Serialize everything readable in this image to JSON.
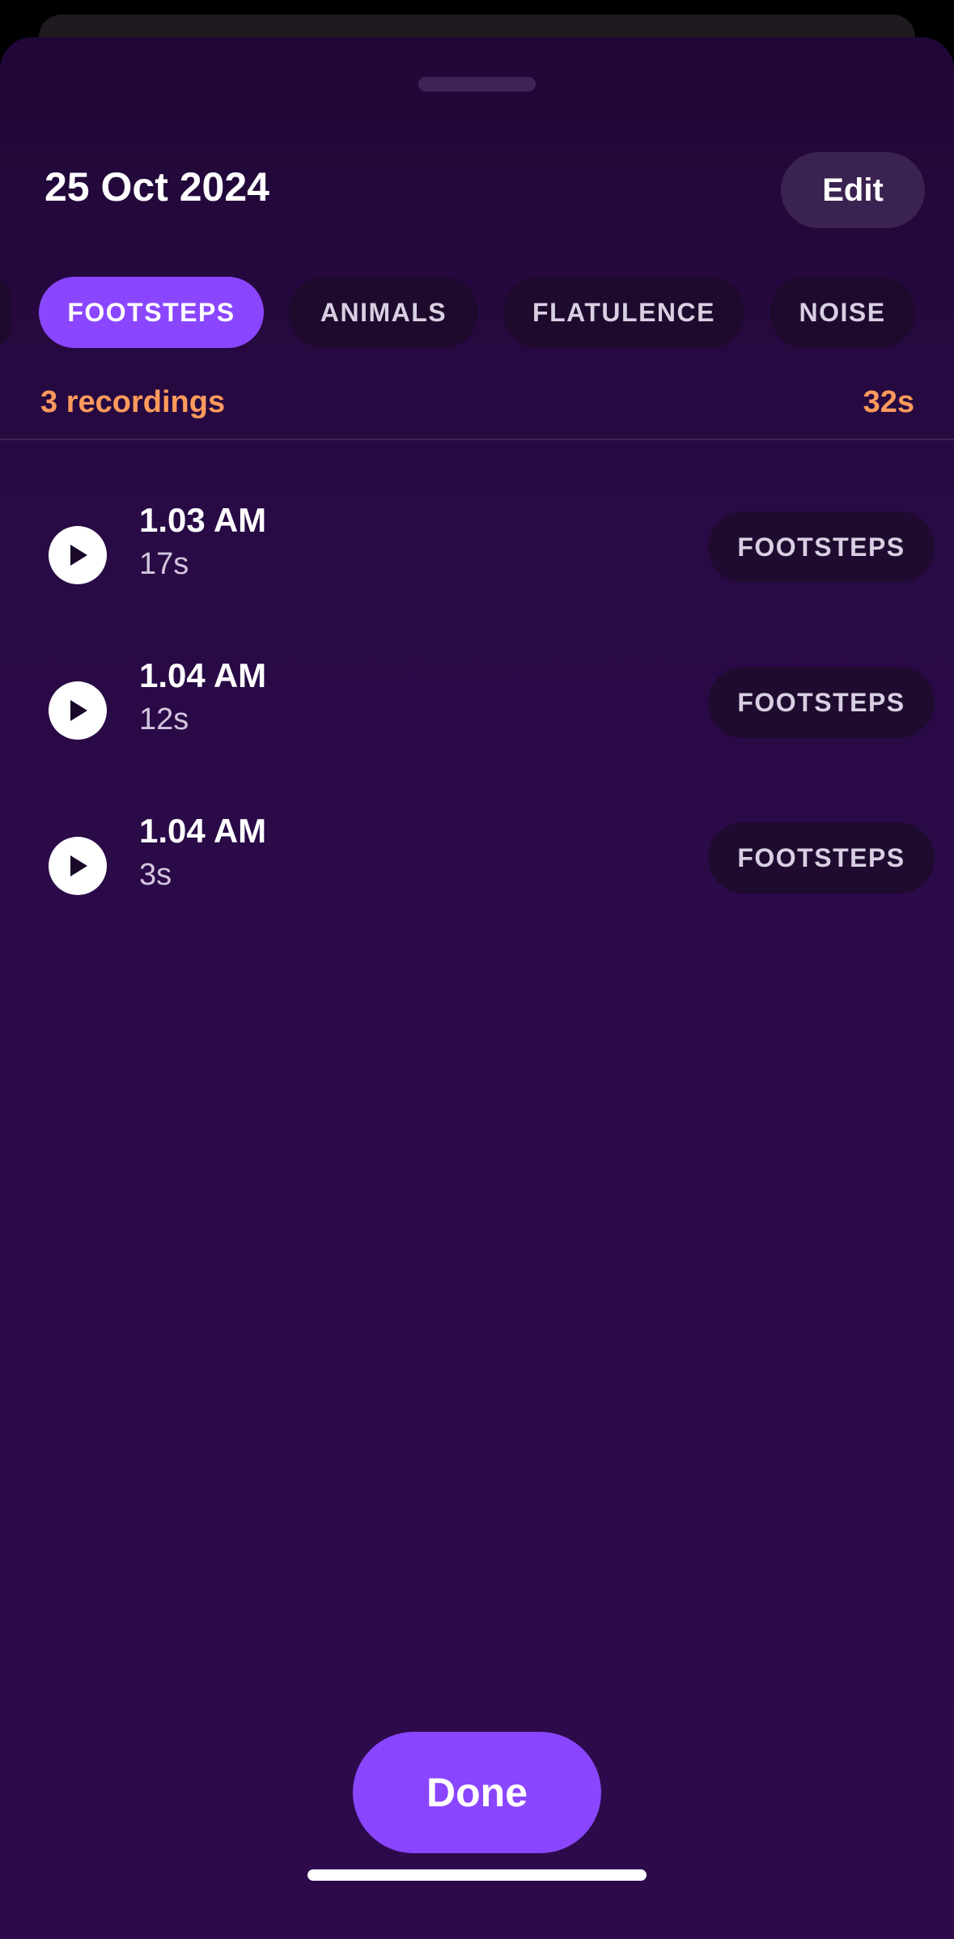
{
  "sheet": {
    "title": "25 Oct 2024",
    "edit_label": "Edit",
    "done_label": "Done"
  },
  "filters": [
    {
      "label": "FOOTSTEPS",
      "active": true
    },
    {
      "label": "ANIMALS",
      "active": false
    },
    {
      "label": "FLATULENCE",
      "active": false
    },
    {
      "label": "NOISE",
      "active": false
    }
  ],
  "summary": {
    "count_text": "3 recordings",
    "total_duration": "32s"
  },
  "recordings": [
    {
      "time": "1.03 AM",
      "duration": "17s",
      "tag": "FOOTSTEPS"
    },
    {
      "time": "1.04 AM",
      "duration": "12s",
      "tag": "FOOTSTEPS"
    },
    {
      "time": "1.04 AM",
      "duration": "3s",
      "tag": "FOOTSTEPS"
    }
  ],
  "icons": {
    "play": "play-icon"
  },
  "colors": {
    "accent": "#8a46ff",
    "summary": "#ff9a5c",
    "background": "#2b0a4a"
  }
}
